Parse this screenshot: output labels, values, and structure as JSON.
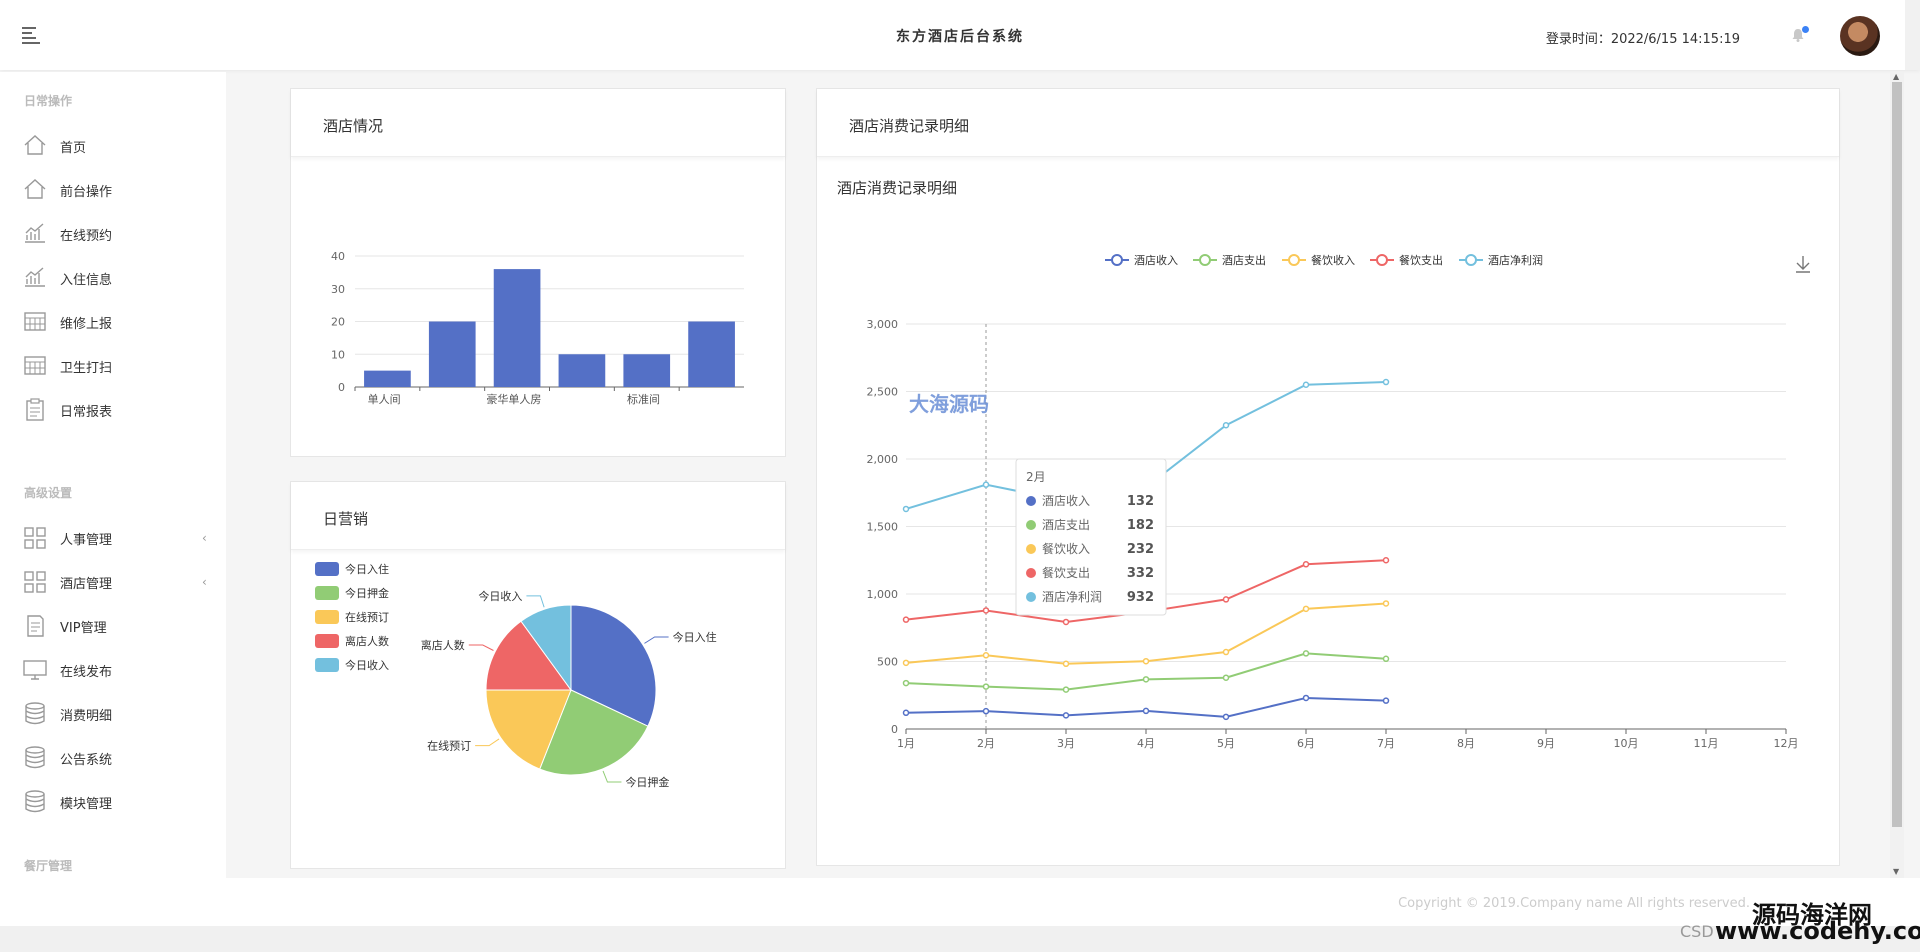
{
  "header": {
    "title": "东方酒店后台系统",
    "login_label": "登录时间：2022/6/15 14:15:19"
  },
  "sidebar": {
    "sections": [
      {
        "title": "日常操作",
        "items": [
          {
            "label": "首页",
            "icon": "home-icon"
          },
          {
            "label": "前台操作",
            "icon": "home-icon"
          },
          {
            "label": "在线预约",
            "icon": "chart-icon"
          },
          {
            "label": "入住信息",
            "icon": "chart-icon"
          },
          {
            "label": "维修上报",
            "icon": "calendar-icon"
          },
          {
            "label": "卫生打扫",
            "icon": "calendar-icon"
          },
          {
            "label": "日常报表",
            "icon": "clipboard-icon"
          }
        ]
      },
      {
        "title": "高级设置",
        "items": [
          {
            "label": "人事管理",
            "icon": "grid-icon",
            "expandable": true
          },
          {
            "label": "酒店管理",
            "icon": "grid-icon",
            "expandable": true
          },
          {
            "label": "VIP管理",
            "icon": "document-icon"
          },
          {
            "label": "在线发布",
            "icon": "monitor-icon"
          },
          {
            "label": "消费明细",
            "icon": "database-icon"
          },
          {
            "label": "公告系统",
            "icon": "database-icon"
          },
          {
            "label": "模块管理",
            "icon": "database-icon"
          }
        ]
      },
      {
        "title": "餐厅管理",
        "items": []
      }
    ]
  },
  "panels": {
    "hotel_status": {
      "title": "酒店情况"
    },
    "daily_sales": {
      "title": "日营销"
    },
    "consumption": {
      "title": "酒店消费记录明细",
      "chart_title": "酒店消费记录明细"
    }
  },
  "watermark": "大海源码",
  "footer": {
    "copyright": "Copyright © 2019.Company name All rights reserved.",
    "brand": "源码海洋网",
    "url": "www.codehy.com",
    "csd": "CSD"
  },
  "colors": {
    "blue": "#5470c6",
    "green": "#91cc75",
    "yellow": "#fac858",
    "red": "#ee6666",
    "cyan": "#73c0de"
  },
  "chart_data": [
    {
      "type": "bar",
      "categories": [
        "单人间",
        "",
        "豪华单人房",
        "",
        "标准间",
        ""
      ],
      "values": [
        5,
        20,
        36,
        10,
        10,
        20
      ],
      "title": "",
      "ylim": [
        0,
        40
      ],
      "yticks": [
        0,
        10,
        20,
        30,
        40
      ],
      "grid": true
    },
    {
      "type": "pie",
      "labels": [
        "今日入住",
        "今日押金",
        "在线预订",
        "离店人数",
        "今日收入"
      ],
      "values": [
        32,
        24,
        19,
        15,
        10
      ],
      "legend": "top-left"
    },
    {
      "type": "line",
      "title": "酒店消费记录明细",
      "categories": [
        "1月",
        "2月",
        "3月",
        "4月",
        "5月",
        "6月",
        "7月",
        "8月",
        "9月",
        "10月",
        "11月",
        "12月"
      ],
      "ylim": [
        0,
        3000
      ],
      "yticks": [
        "0",
        "500",
        "1,000",
        "1,500",
        "2,000",
        "2,500",
        "3,000"
      ],
      "legend": "top-center",
      "series": [
        {
          "name": "酒店收入",
          "values": [
            120,
            132,
            101,
            134,
            90,
            230,
            210
          ]
        },
        {
          "name": "酒店支出",
          "values": [
            340,
            314,
            292,
            368,
            380,
            560,
            520
          ]
        },
        {
          "name": "餐饮收入",
          "values": [
            490,
            546,
            483,
            502,
            570,
            890,
            930
          ]
        },
        {
          "name": "餐饮支出",
          "values": [
            810,
            878,
            793,
            868,
            960,
            1220,
            1250
          ]
        },
        {
          "name": "酒店净利润",
          "values": [
            1630,
            1810,
            1690,
            1790,
            2250,
            2550,
            2570
          ]
        }
      ],
      "tooltip": {
        "title": "2月",
        "rows": [
          {
            "name": "酒店收入",
            "value": "132"
          },
          {
            "name": "酒店支出",
            "value": "182"
          },
          {
            "name": "餐饮收入",
            "value": "232"
          },
          {
            "name": "餐饮支出",
            "value": "332"
          },
          {
            "name": "酒店净利润",
            "value": "932"
          }
        ]
      }
    }
  ]
}
